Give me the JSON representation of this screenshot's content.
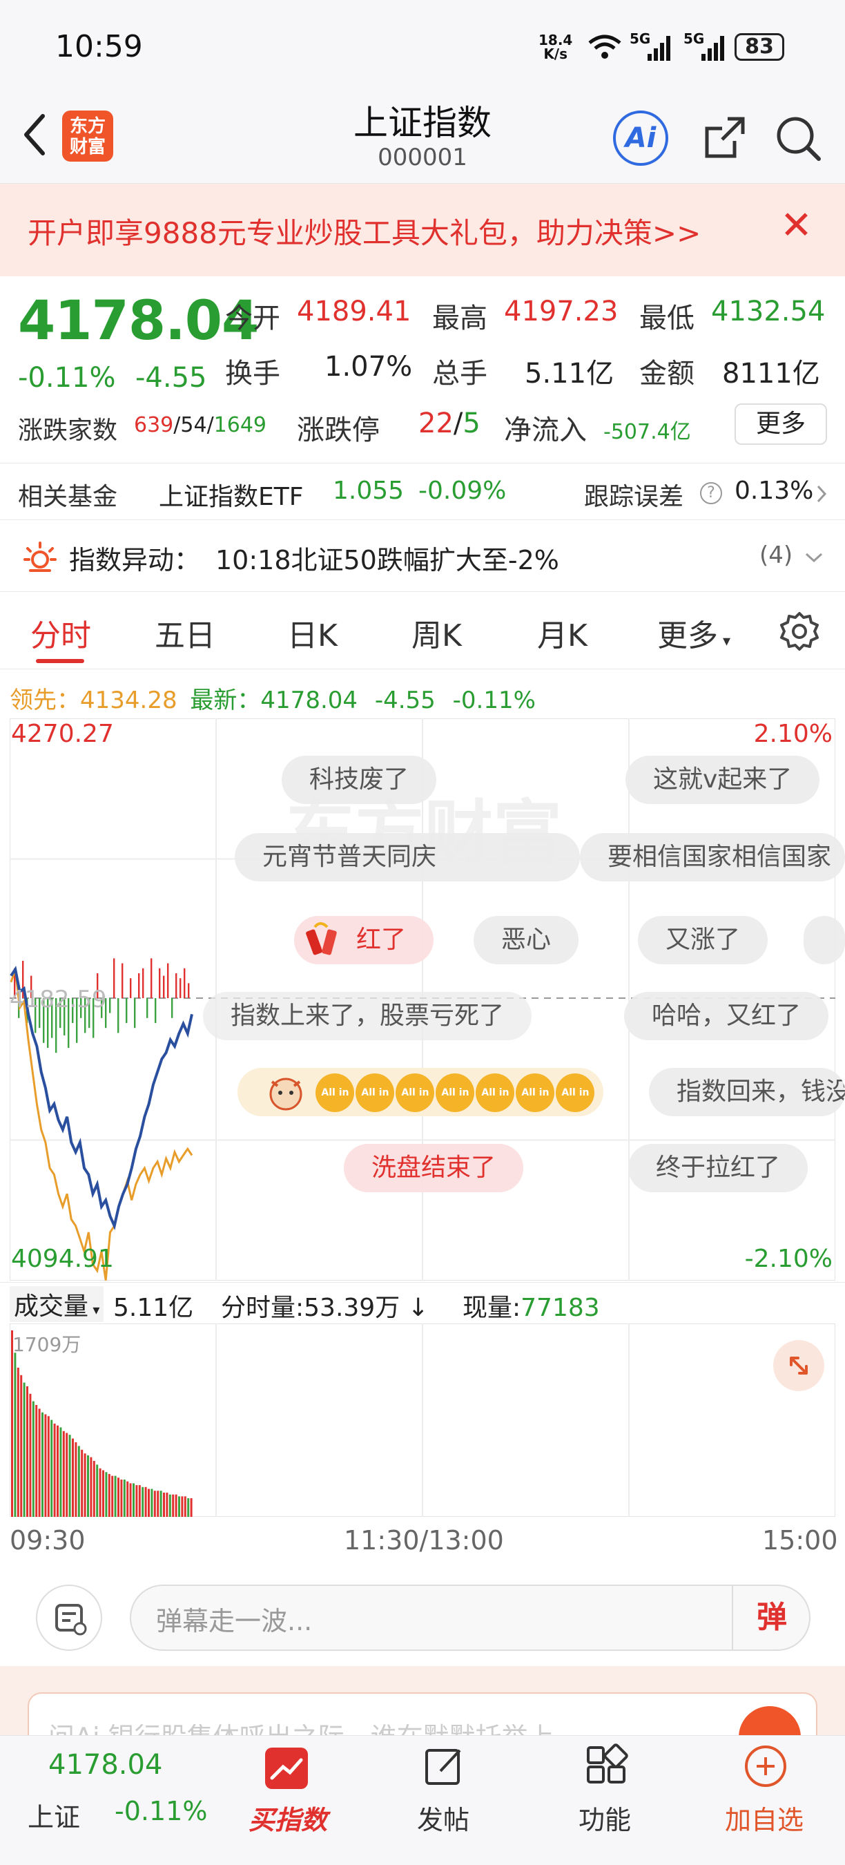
{
  "status": {
    "time": "10:59",
    "speed_top": "18.4",
    "speed_bottom": "K/s",
    "net1": "5G",
    "net2": "5G",
    "battery": "83"
  },
  "header": {
    "logo_line1": "东方",
    "logo_line2": "财富",
    "title": "上证指数",
    "code": "000001",
    "ai_label": "Ai"
  },
  "banner": {
    "text": "开户即享9888元专业炒股工具大礼包，助力决策>>",
    "close": "✕"
  },
  "quote": {
    "price": "4178.04",
    "change_pct": "-0.11%",
    "change_abs": "-4.55",
    "open_label": "今开",
    "open": "4189.41",
    "high_label": "最高",
    "high": "4197.23",
    "low_label": "最低",
    "low": "4132.54",
    "turnover_label": "换手",
    "turnover": "1.07%",
    "volume_label": "总手",
    "volume": "5.11亿",
    "amount_label": "金额",
    "amount": "8111亿",
    "breadth_label": "涨跌家数",
    "up_count": "639",
    "flat_count": "54",
    "down_count": "1649",
    "limit_label": "涨跌停",
    "limit_up": "22",
    "limit_down": "5",
    "netflow_label": "净流入",
    "netflow": "-507.4亿",
    "more_label": "更多"
  },
  "fund": {
    "label": "相关基金",
    "name": "上证指数ETF",
    "price": "1.055",
    "pct": "-0.09%",
    "track_label": "跟踪误差",
    "track_value": "0.13%"
  },
  "alert": {
    "label": "指数异动：",
    "text": "10:18北证50跌幅扩大至-2%",
    "count": "(4)"
  },
  "tabs": [
    "分时",
    "五日",
    "日K",
    "周K",
    "月K",
    "更多"
  ],
  "legend": {
    "lead_label": "领先：",
    "lead_value": "4134.28",
    "latest_label": "最新：",
    "latest_value": "4178.04",
    "chg": "-4.55",
    "pct": "-0.11%"
  },
  "chart": {
    "y_max": "4270.27",
    "y_max_pct": "2.10%",
    "y_min": "4094.91",
    "y_min_pct": "-2.10%",
    "y_mid": "4182.59",
    "watermark": "东方财富",
    "danmu": [
      "科技废了",
      "这就v起来了",
      "元宵节普天同庆",
      "要相信国家相信国家",
      "红了",
      "恶心",
      "又涨了",
      "指数上来了，股票亏死了",
      "哈哈，又红了",
      "指数回来，钱没",
      "洗盘结束了",
      "终于拉红了"
    ],
    "allin_label": "All in"
  },
  "volume": {
    "select_label": "成交量",
    "total": "5.11亿",
    "minute_label": "分时量:",
    "minute_value": "53.39万",
    "now_label": "现量:",
    "now_value": "77183",
    "scale": "1709万"
  },
  "time_axis": {
    "start": "09:30",
    "mid": "11:30/13:00",
    "end": "15:00"
  },
  "comment": {
    "placeholder": "弹幕走一波...",
    "send": "弹"
  },
  "ad": {
    "text": "问Ai  银行股集体呼出之际，谁在默默托举上..."
  },
  "nav": {
    "price": "4178.04",
    "name": "上证",
    "pct": "-0.11%",
    "buy": "买指数",
    "post": "发帖",
    "func": "功能",
    "add": "加自选"
  },
  "chart_data": {
    "type": "line",
    "title": "",
    "ylim": [
      4094.91,
      4270.27
    ],
    "prev_close": 4182.59,
    "x_range": [
      "09:30",
      "15:00"
    ],
    "series": [
      {
        "name": "最新",
        "color": "#2a4f9e",
        "values": [
          4190,
          4192,
          4185,
          4186,
          4178,
          4172,
          4168,
          4160,
          4155,
          4148,
          4150,
          4145,
          4142,
          4146,
          4138,
          4135,
          4138,
          4130,
          4128,
          4122,
          4125,
          4118,
          4120,
          4115,
          4112,
          4118,
          4122,
          4125,
          4130,
          4136,
          4140,
          4146,
          4150,
          4156,
          4160,
          4164,
          4166,
          4170,
          4168,
          4172,
          4175,
          4172,
          4178
        ]
      },
      {
        "name": "领先",
        "color": "#e89d2a",
        "values": [
          4188,
          4192,
          4180,
          4182,
          4170,
          4160,
          4150,
          4142,
          4138,
          4130,
          4128,
          4122,
          4118,
          4122,
          4114,
          4112,
          4108,
          4104,
          4110,
          4100,
          4098,
          4104,
          4095,
          4110,
          4112,
          4118,
          4122,
          4126,
          4120,
          4125,
          4128,
          4130,
          4126,
          4130,
          4132,
          4128,
          4133,
          4130,
          4135,
          4132,
          4134,
          4136,
          4134
        ]
      }
    ],
    "bars": [
      12,
      -8,
      15,
      -10,
      9,
      -14,
      -12,
      -18,
      -20,
      -16,
      -22,
      -12,
      -15,
      -20,
      -10,
      -18,
      -8,
      -14,
      -12,
      -16,
      10,
      -8,
      -12,
      -6,
      16,
      -14,
      14,
      -10,
      8,
      -12,
      10,
      12,
      -8,
      16,
      -10,
      12,
      9,
      14,
      -8,
      10,
      8,
      12,
      6
    ],
    "volume_bars": [
      100,
      88,
      80,
      76,
      72,
      70,
      66,
      62,
      60,
      58,
      56,
      55,
      54,
      52,
      50,
      49,
      48,
      46,
      45,
      44,
      42,
      40,
      38,
      36,
      34,
      33,
      32,
      30,
      28,
      26,
      25,
      24,
      23,
      22,
      22,
      21,
      20,
      20,
      19,
      18,
      18,
      17,
      17,
      16,
      16,
      15,
      15,
      14,
      14,
      14,
      13,
      13,
      12,
      12,
      12,
      11,
      11,
      11,
      10,
      10
    ]
  }
}
